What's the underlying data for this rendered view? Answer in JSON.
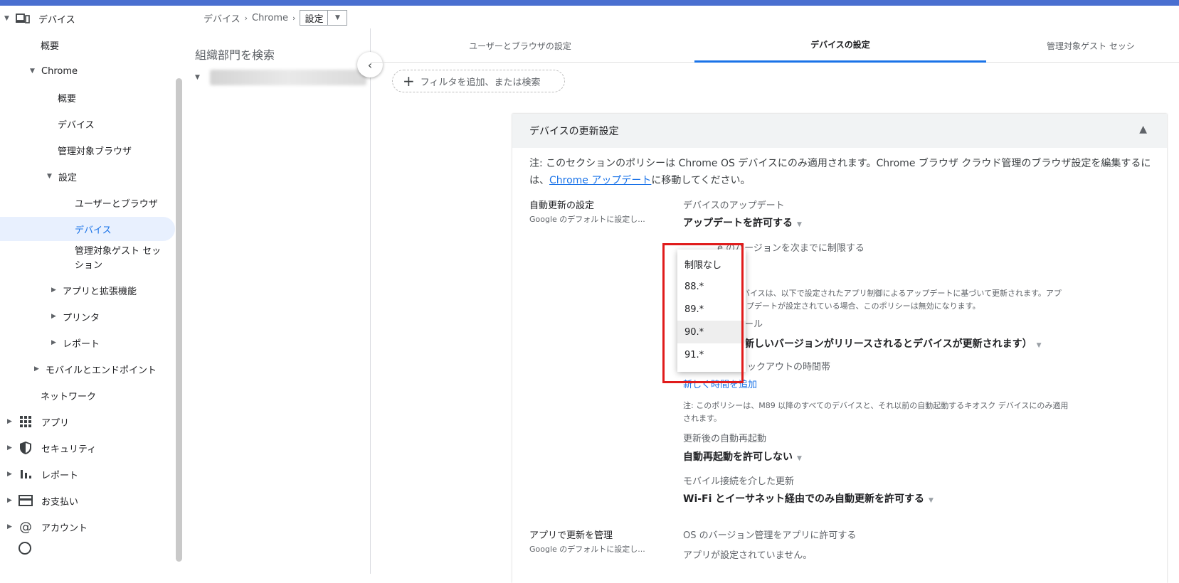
{
  "colors": {
    "accent": "#1a73e8",
    "topbar": "#4a6fd0",
    "highlight_box": "#e01b1b"
  },
  "nav": {
    "devices": "デバイス",
    "overview": "概要",
    "chrome": "Chrome",
    "chrome_overview": "概要",
    "chrome_devices": "デバイス",
    "managed_browsers": "管理対象ブラウザ",
    "settings": "設定",
    "users_browsers": "ユーザーとブラウザ",
    "device": "デバイス",
    "guest_line1": "管理対象ゲスト セッ",
    "guest_line2": "ション",
    "apps_ext": "アプリと拡張機能",
    "printers": "プリンタ",
    "reports": "レポート",
    "mobile": "モバイルとエンドポイント",
    "network": "ネットワーク",
    "apps": "アプリ",
    "security": "セキュリティ",
    "reports2": "レポート",
    "billing": "お支払い",
    "account": "アカウント"
  },
  "breadcrumb": {
    "b1": "デバイス",
    "b2": "Chrome",
    "current": "設定",
    "sep": "›"
  },
  "org": {
    "title": "組織部門を検索"
  },
  "tabs": {
    "users": "ユーザーとブラウザの設定",
    "devices": "デバイスの設定",
    "guest": "管理対象ゲスト セッシ"
  },
  "filter": {
    "label": "フィルタを追加、または検索"
  },
  "card": {
    "title": "デバイスの更新設定",
    "note_part1": "注: このセクションのポリシーは Chrome OS デバイスにのみ適用されます。Chrome ブラウザ クラウド管理のブラウザ設定を編集するには、",
    "note_link": "Chrome アップデート",
    "note_part2": "に移動してください。",
    "auto_update_name": "自動更新の設定",
    "auto_update_sub": "Google のデフォルトに設定し...",
    "device_update_label": "デバイスのアップデート",
    "device_update_value": "アップデートを許可する",
    "version_limit_label": "e のバージョンを次までに制限する",
    "kiosk_note1": "デバイスは、以下で設定されたアプリ制御によるアップデートに基づいて更新されます。アプ",
    "kiosk_note2": "ップデートが設定されている場合、このポリシーは無効になります。",
    "rollout_label_frag": "ール",
    "rollout_value": "新しいバージョンがリリースされるとデバイスが更新されます）",
    "blackout_label": "ックアウトの時間帯",
    "add_time": "新しく時間を追加",
    "m89_note1": "注: このポリシーは、M89 以降のすべてのデバイスと、それ以前の自動起動するキオスク デバイスにのみ適用",
    "m89_note2": "されます。",
    "reboot_label": "更新後の自動再起動",
    "reboot_value": "自動再起動を許可しない",
    "mobile_label": "モバイル接続を介した更新",
    "mobile_value": "Wi-Fi とイーサネット経由でのみ自動更新を許可する",
    "app_manage_name": "アプリで更新を管理",
    "app_manage_sub": "Google のデフォルトに設定し...",
    "os_version_label": "OS のバージョン管理をアプリに許可する",
    "no_app": "アプリが設定されていません。"
  },
  "dropdown": {
    "options": [
      "制限なし",
      "88.*",
      "89.*",
      "90.*",
      "91.*"
    ],
    "hovered": "90.*"
  }
}
